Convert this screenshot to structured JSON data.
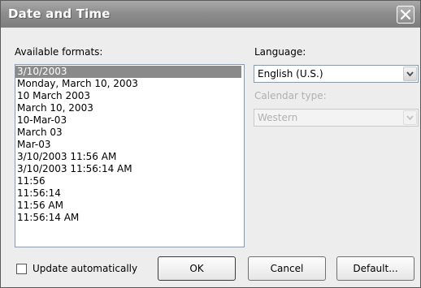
{
  "window": {
    "title": "Date and Time"
  },
  "formats": {
    "label": "Available formats:",
    "items": [
      "3/10/2003",
      "Monday, March 10, 2003",
      "10 March 2003",
      "March 10, 2003",
      "10-Mar-03",
      "March 03",
      "Mar-03",
      "3/10/2003 11:56 AM",
      "3/10/2003 11:56:14 AM",
      "11:56",
      "11:56:14",
      "11:56 AM",
      "11:56:14 AM"
    ]
  },
  "language": {
    "label": "Language:",
    "value": "English (U.S.)"
  },
  "calendar": {
    "label": "Calendar type:",
    "value": "Western"
  },
  "update": {
    "label": "Update automatically"
  },
  "buttons": {
    "ok": "OK",
    "cancel": "Cancel",
    "default": "Default..."
  }
}
